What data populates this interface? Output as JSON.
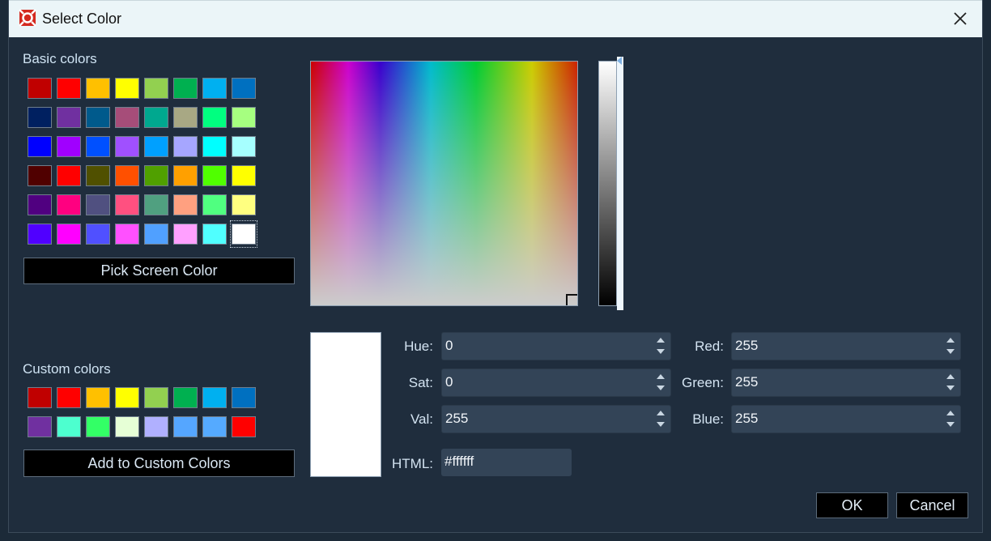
{
  "window": {
    "title": "Select Color",
    "app_icon": "app-logo-icon",
    "close_icon": "close-icon"
  },
  "basic_colors": {
    "label": "Basic colors",
    "swatches": [
      "#c00000",
      "#ff0000",
      "#ffc000",
      "#ffff00",
      "#92d050",
      "#00b050",
      "#00b0f0",
      "#0070c0",
      "#002060",
      "#7030a0",
      "#005a8c",
      "#a64d79",
      "#00a88f",
      "#a8a884",
      "#00ff80",
      "#a6ff80",
      "#0000ff",
      "#a000ff",
      "#0050ff",
      "#a050ff",
      "#00a0ff",
      "#a6a6ff",
      "#00ffff",
      "#a6ffff",
      "#500000",
      "#ff0000",
      "#505000",
      "#ff5000",
      "#50a000",
      "#ffa000",
      "#50ff00",
      "#ffff00",
      "#500080",
      "#ff0080",
      "#505080",
      "#ff5080",
      "#50a080",
      "#ffa080",
      "#50ff80",
      "#ffff80",
      "#5000ff",
      "#ff00ff",
      "#5050ff",
      "#ff50ff",
      "#50a0ff",
      "#ffa0ff",
      "#50ffff",
      "#ffffff"
    ],
    "selected_index": 47
  },
  "pick_screen_label": "Pick Screen Color",
  "custom_colors": {
    "label": "Custom colors",
    "swatches": [
      "#c00000",
      "#ff0000",
      "#ffc000",
      "#ffff00",
      "#92d050",
      "#00b050",
      "#00b0f0",
      "#0070c0",
      "#7030a0",
      "#4dffcf",
      "#33ff66",
      "#e6ffd6",
      "#b0b0ff",
      "#55a6ff",
      "#55aaff",
      "#ff0000"
    ]
  },
  "add_custom_label": "Add to Custom Colors",
  "fields": {
    "hue": {
      "label": "Hue:",
      "value": "0"
    },
    "sat": {
      "label": "Sat:",
      "value": "0"
    },
    "val": {
      "label": "Val:",
      "value": "255"
    },
    "red": {
      "label": "Red:",
      "value": "255"
    },
    "green": {
      "label": "Green:",
      "value": "255"
    },
    "blue": {
      "label": "Blue:",
      "value": "255"
    },
    "html": {
      "label": "HTML:",
      "value": "#ffffff"
    }
  },
  "current_color": "#ffffff",
  "buttons": {
    "ok": "OK",
    "cancel": "Cancel"
  }
}
